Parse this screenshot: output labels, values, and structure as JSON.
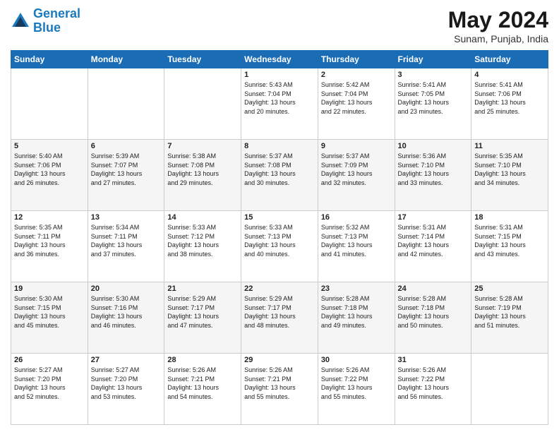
{
  "header": {
    "logo_line1": "General",
    "logo_line2": "Blue",
    "month": "May 2024",
    "location": "Sunam, Punjab, India"
  },
  "weekdays": [
    "Sunday",
    "Monday",
    "Tuesday",
    "Wednesday",
    "Thursday",
    "Friday",
    "Saturday"
  ],
  "weeks": [
    [
      {
        "day": "",
        "info": ""
      },
      {
        "day": "",
        "info": ""
      },
      {
        "day": "",
        "info": ""
      },
      {
        "day": "1",
        "info": "Sunrise: 5:43 AM\nSunset: 7:04 PM\nDaylight: 13 hours\nand 20 minutes."
      },
      {
        "day": "2",
        "info": "Sunrise: 5:42 AM\nSunset: 7:04 PM\nDaylight: 13 hours\nand 22 minutes."
      },
      {
        "day": "3",
        "info": "Sunrise: 5:41 AM\nSunset: 7:05 PM\nDaylight: 13 hours\nand 23 minutes."
      },
      {
        "day": "4",
        "info": "Sunrise: 5:41 AM\nSunset: 7:06 PM\nDaylight: 13 hours\nand 25 minutes."
      }
    ],
    [
      {
        "day": "5",
        "info": "Sunrise: 5:40 AM\nSunset: 7:06 PM\nDaylight: 13 hours\nand 26 minutes."
      },
      {
        "day": "6",
        "info": "Sunrise: 5:39 AM\nSunset: 7:07 PM\nDaylight: 13 hours\nand 27 minutes."
      },
      {
        "day": "7",
        "info": "Sunrise: 5:38 AM\nSunset: 7:08 PM\nDaylight: 13 hours\nand 29 minutes."
      },
      {
        "day": "8",
        "info": "Sunrise: 5:37 AM\nSunset: 7:08 PM\nDaylight: 13 hours\nand 30 minutes."
      },
      {
        "day": "9",
        "info": "Sunrise: 5:37 AM\nSunset: 7:09 PM\nDaylight: 13 hours\nand 32 minutes."
      },
      {
        "day": "10",
        "info": "Sunrise: 5:36 AM\nSunset: 7:10 PM\nDaylight: 13 hours\nand 33 minutes."
      },
      {
        "day": "11",
        "info": "Sunrise: 5:35 AM\nSunset: 7:10 PM\nDaylight: 13 hours\nand 34 minutes."
      }
    ],
    [
      {
        "day": "12",
        "info": "Sunrise: 5:35 AM\nSunset: 7:11 PM\nDaylight: 13 hours\nand 36 minutes."
      },
      {
        "day": "13",
        "info": "Sunrise: 5:34 AM\nSunset: 7:11 PM\nDaylight: 13 hours\nand 37 minutes."
      },
      {
        "day": "14",
        "info": "Sunrise: 5:33 AM\nSunset: 7:12 PM\nDaylight: 13 hours\nand 38 minutes."
      },
      {
        "day": "15",
        "info": "Sunrise: 5:33 AM\nSunset: 7:13 PM\nDaylight: 13 hours\nand 40 minutes."
      },
      {
        "day": "16",
        "info": "Sunrise: 5:32 AM\nSunset: 7:13 PM\nDaylight: 13 hours\nand 41 minutes."
      },
      {
        "day": "17",
        "info": "Sunrise: 5:31 AM\nSunset: 7:14 PM\nDaylight: 13 hours\nand 42 minutes."
      },
      {
        "day": "18",
        "info": "Sunrise: 5:31 AM\nSunset: 7:15 PM\nDaylight: 13 hours\nand 43 minutes."
      }
    ],
    [
      {
        "day": "19",
        "info": "Sunrise: 5:30 AM\nSunset: 7:15 PM\nDaylight: 13 hours\nand 45 minutes."
      },
      {
        "day": "20",
        "info": "Sunrise: 5:30 AM\nSunset: 7:16 PM\nDaylight: 13 hours\nand 46 minutes."
      },
      {
        "day": "21",
        "info": "Sunrise: 5:29 AM\nSunset: 7:17 PM\nDaylight: 13 hours\nand 47 minutes."
      },
      {
        "day": "22",
        "info": "Sunrise: 5:29 AM\nSunset: 7:17 PM\nDaylight: 13 hours\nand 48 minutes."
      },
      {
        "day": "23",
        "info": "Sunrise: 5:28 AM\nSunset: 7:18 PM\nDaylight: 13 hours\nand 49 minutes."
      },
      {
        "day": "24",
        "info": "Sunrise: 5:28 AM\nSunset: 7:18 PM\nDaylight: 13 hours\nand 50 minutes."
      },
      {
        "day": "25",
        "info": "Sunrise: 5:28 AM\nSunset: 7:19 PM\nDaylight: 13 hours\nand 51 minutes."
      }
    ],
    [
      {
        "day": "26",
        "info": "Sunrise: 5:27 AM\nSunset: 7:20 PM\nDaylight: 13 hours\nand 52 minutes."
      },
      {
        "day": "27",
        "info": "Sunrise: 5:27 AM\nSunset: 7:20 PM\nDaylight: 13 hours\nand 53 minutes."
      },
      {
        "day": "28",
        "info": "Sunrise: 5:26 AM\nSunset: 7:21 PM\nDaylight: 13 hours\nand 54 minutes."
      },
      {
        "day": "29",
        "info": "Sunrise: 5:26 AM\nSunset: 7:21 PM\nDaylight: 13 hours\nand 55 minutes."
      },
      {
        "day": "30",
        "info": "Sunrise: 5:26 AM\nSunset: 7:22 PM\nDaylight: 13 hours\nand 55 minutes."
      },
      {
        "day": "31",
        "info": "Sunrise: 5:26 AM\nSunset: 7:22 PM\nDaylight: 13 hours\nand 56 minutes."
      },
      {
        "day": "",
        "info": ""
      }
    ]
  ]
}
